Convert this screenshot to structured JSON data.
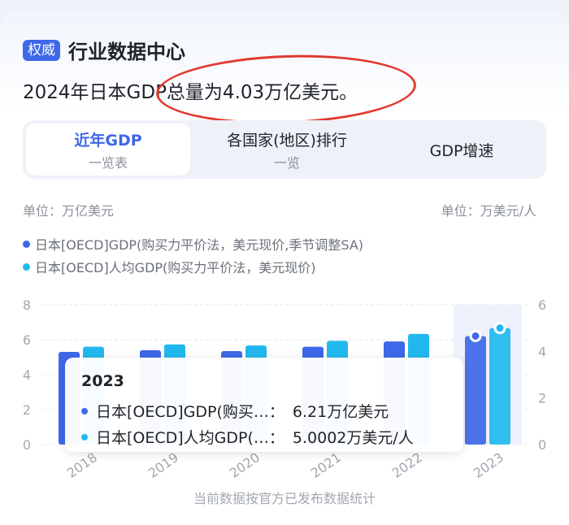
{
  "header": {
    "badge": "权威",
    "title": "行业数据中心"
  },
  "headline": "2024年日本GDP总量为4.03万亿美元。",
  "annotation_color": "#e23a30",
  "tabs": [
    {
      "label": "近年GDP",
      "sub": "一览表",
      "active": true
    },
    {
      "label": "各国家(地区)排行",
      "sub": "一览",
      "active": false
    },
    {
      "label": "GDP增速",
      "sub": "",
      "active": false
    }
  ],
  "units": {
    "left": "单位：万亿美元",
    "right": "单位：万美元/人"
  },
  "legend": [
    {
      "label": "日本[OECD]GDP(购买力平价法，美元现价,季节调整SA)",
      "color": "#3f68e8"
    },
    {
      "label": "日本[OECD]人均GDP(购买力平价法，美元现价)",
      "color": "#22b8ef"
    }
  ],
  "chart_data": {
    "type": "bar",
    "categories": [
      "2018",
      "2019",
      "2020",
      "2021",
      "2022",
      "2023"
    ],
    "series": [
      {
        "name": "日本[OECD]GDP(购买力平价法，美元现价,季节调整SA)",
        "axis": "left",
        "color": "#3f68e8",
        "values": [
          5.3,
          5.4,
          5.35,
          5.6,
          5.9,
          6.21
        ]
      },
      {
        "name": "日本[OECD]人均GDP(购买力平价法，美元现价)",
        "axis": "right",
        "color": "#22b8ef",
        "values": [
          4.2,
          4.3,
          4.25,
          4.45,
          4.75,
          5.0002
        ]
      }
    ],
    "y_left": {
      "ticks": [
        "0",
        "2",
        "4",
        "6",
        "8"
      ],
      "range": [
        0,
        8
      ]
    },
    "y_right": {
      "ticks": [
        "0",
        "2",
        "4",
        "6"
      ],
      "range": [
        0,
        6
      ]
    },
    "highlight_index": 5,
    "grid": true
  },
  "tooltip": {
    "year": "2023",
    "rows": [
      {
        "label": "日本[OECD]GDP(购买…：",
        "value": "6.21万亿美元",
        "color": "#3f68e8"
      },
      {
        "label": "日本[OECD]人均GDP(…：",
        "value": "5.0002万美元/人",
        "color": "#22b8ef"
      }
    ]
  },
  "footer": "当前数据按官方已发布数据统计"
}
